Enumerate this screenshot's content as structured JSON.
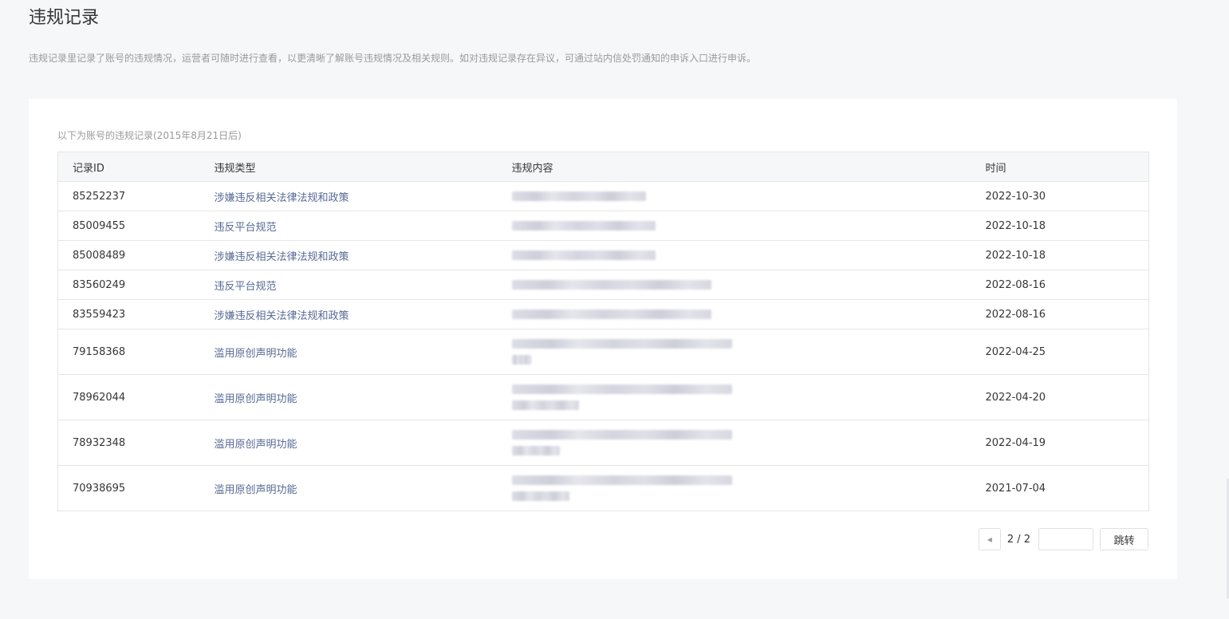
{
  "header": {
    "title": "违规记录",
    "description": "违规记录里记录了账号的违规情况，运营者可随时进行查看，以更清晰了解账号违规情况及相关规则。如对违规记录存在异议，可通过站内信处罚通知的申诉入口进行申诉。"
  },
  "card": {
    "subtitle": "以下为账号的违规记录(2015年8月21日后)"
  },
  "table": {
    "columns": [
      "记录ID",
      "违规类型",
      "违规内容",
      "时间"
    ],
    "rows": [
      {
        "id": "85252237",
        "type": "涉嫌违反相关法律法规和政策",
        "date": "2022-10-30"
      },
      {
        "id": "85009455",
        "type": "违反平台规范",
        "date": "2022-10-18"
      },
      {
        "id": "85008489",
        "type": "涉嫌违反相关法律法规和政策",
        "date": "2022-10-18"
      },
      {
        "id": "83560249",
        "type": "违反平台规范",
        "date": "2022-08-16"
      },
      {
        "id": "83559423",
        "type": "涉嫌违反相关法律法规和政策",
        "date": "2022-08-16"
      },
      {
        "id": "79158368",
        "type": "滥用原创声明功能",
        "date": "2022-04-25"
      },
      {
        "id": "78962044",
        "type": "滥用原创声明功能",
        "date": "2022-04-20"
      },
      {
        "id": "78932348",
        "type": "滥用原创声明功能",
        "date": "2022-04-19"
      },
      {
        "id": "70938695",
        "type": "滥用原创声明功能",
        "date": "2021-07-04"
      }
    ]
  },
  "pagination": {
    "current_of_total": "2 / 2",
    "jump_label": "跳转",
    "prev_icon": "caret-left-icon"
  },
  "colors": {
    "page_bg": "#f6f7f9",
    "card_bg": "#ffffff",
    "link_text": "#576b95",
    "muted_text": "#9a9a9a"
  }
}
